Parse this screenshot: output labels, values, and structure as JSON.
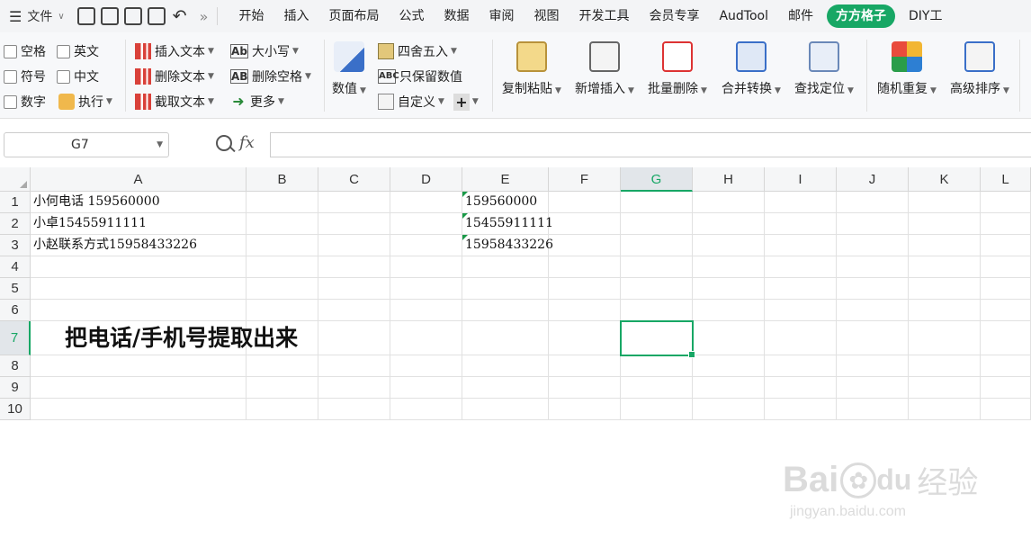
{
  "menubar": {
    "file_label": "文件",
    "more_glyph": "»",
    "tabs": [
      "开始",
      "插入",
      "页面布局",
      "公式",
      "数据",
      "审阅",
      "视图",
      "开发工具",
      "会员专享",
      "AudTool",
      "邮件",
      "方方格子",
      "DIY工"
    ]
  },
  "ribbon": {
    "chk_space": "空格",
    "chk_english": "英文",
    "chk_symbol": "符号",
    "chk_chinese": "中文",
    "chk_number": "数字",
    "execute": "执行",
    "insert_text": "插入文本",
    "delete_text": "删除文本",
    "extract_text": "截取文本",
    "case": "大小写",
    "delete_spaces": "删除空格",
    "more": "更多",
    "numeric": "数值",
    "round": "四舍五入",
    "keep_numeric": "只保留数值",
    "custom": "自定义",
    "copy_paste": "复制粘贴",
    "add_insert": "新增插入",
    "batch_delete": "批量删除",
    "merge_convert": "合并转换",
    "find_locate": "查找定位",
    "random_repeat": "随机重复",
    "advanced_sort": "高级排序"
  },
  "formula_bar": {
    "name_box": "G7",
    "fx": "fx",
    "formula": ""
  },
  "sheet": {
    "columns": [
      "A",
      "B",
      "C",
      "D",
      "E",
      "F",
      "G",
      "H",
      "I",
      "J",
      "K",
      "L"
    ],
    "rows": [
      "1",
      "2",
      "3",
      "4",
      "5",
      "6",
      "7",
      "8",
      "9",
      "10"
    ],
    "selected_cell": "G7",
    "cells": {
      "A1": "小何电话 159560000",
      "A2": "小卓15455911111",
      "A3": "小赵联系方式15958433226",
      "E1": "159560000",
      "E2": "15455911111",
      "E3": "15958433226",
      "A7": "把电话/手机号提取出来"
    },
    "accent": "#17a765"
  },
  "watermark": {
    "brand": "Bai",
    "brand_tail": "du",
    "cn": "经验",
    "url": "jingyan.baidu.com"
  }
}
